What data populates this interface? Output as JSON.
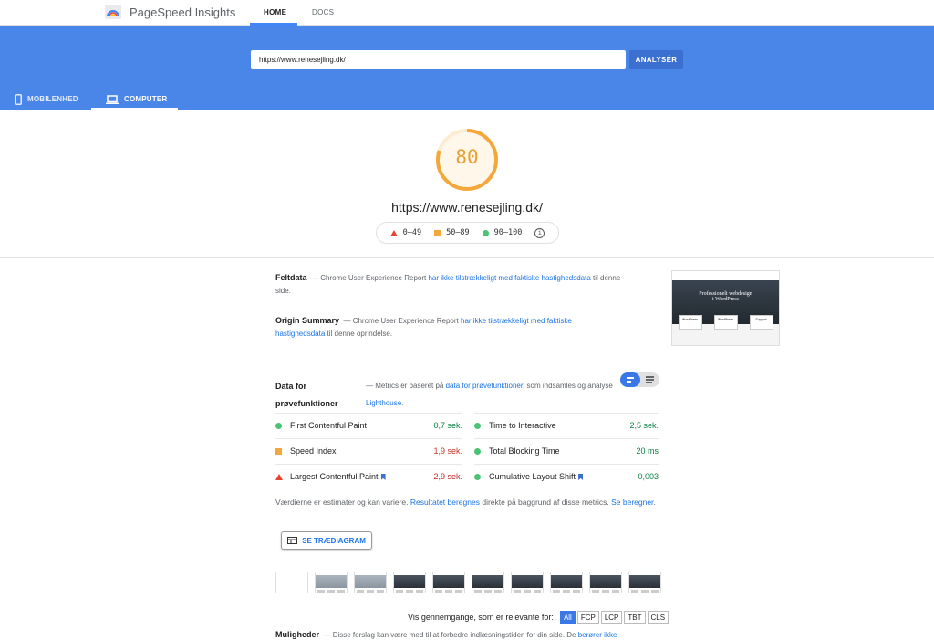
{
  "app": {
    "title": "PageSpeed Insights"
  },
  "nav": {
    "home": "HOME",
    "docs": "DOCS"
  },
  "search": {
    "value": "https://www.renesejling.dk/",
    "button": "ANALYSÉR"
  },
  "device_tabs": {
    "mobile": "MOBILENHED",
    "desktop": "COMPUTER",
    "selected": "desktop"
  },
  "score": {
    "value": "80",
    "fraction": 0.8,
    "color": "#f4a83b"
  },
  "tested_url": "https://www.renesejling.dk/",
  "legend": {
    "poor": "0–49",
    "average": "50–89",
    "good": "90–100"
  },
  "field_data": {
    "title": "Feltdata",
    "text_before": "— Chrome User Experience Report",
    "link": "har ikke tilstrækkeligt med faktiske hastighedsdata",
    "text_after": "til denne side."
  },
  "origin_summary": {
    "title": "Origin Summary",
    "text_before": "— Chrome User Experience Report",
    "link": "har ikke tilstrækkeligt med faktiske hastighedsdata",
    "text_after": "til denne oprindelse."
  },
  "thumbnail": {
    "hero_line1": "Professionelt webdesign",
    "hero_line2": "i WordPress",
    "card1": "WordPress",
    "card2": "WordPress",
    "card3": "Support"
  },
  "lab_data": {
    "title_line1": "Data for",
    "title_line2": "prøvefunktioner",
    "text_before": "— Metrics er baseret på",
    "link1": "data for prøvefunktioner",
    "text_mid": ", som indsamles og analyse",
    "link2": "Lighthouse",
    "text_end": "."
  },
  "metrics": [
    {
      "label": "First Contentful Paint",
      "value": "0,7 sek.",
      "status": "good"
    },
    {
      "label": "Time to Interactive",
      "value": "2,5 sek.",
      "status": "good"
    },
    {
      "label": "Speed Index",
      "value": "1,9 sek.",
      "status": "average"
    },
    {
      "label": "Total Blocking Time",
      "value": "20 ms",
      "status": "good"
    },
    {
      "label": "Largest Contentful Paint",
      "value": "2,9 sek.",
      "status": "poor"
    },
    {
      "label": "Cumulative Layout Shift",
      "value": "0,003",
      "status": "good"
    }
  ],
  "note": {
    "text_before": "Værdierne er estimater og kan variere.",
    "link1": "Resultatet beregnes",
    "text_mid": "direkte på baggrund af disse metrics.",
    "link2": "Se beregner",
    "text_end": "."
  },
  "treemap_button": "SE TRÆDIAGRAM",
  "filter": {
    "label": "Vis gennemgange, som er relevante for:",
    "options": [
      "All",
      "FCP",
      "LCP",
      "TBT",
      "CLS"
    ],
    "selected": "All"
  },
  "opportunities": {
    "title": "Muligheder",
    "text": "— Disse forslag kan være med til at forbedre indlæsningstiden for din side. De",
    "link": "berører ikke"
  }
}
